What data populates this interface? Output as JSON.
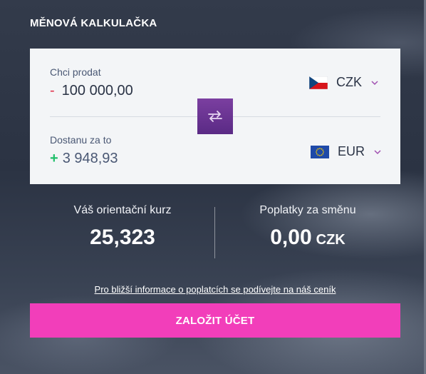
{
  "title": "MĚNOVÁ KALKULAČKA",
  "sell": {
    "label": "Chci prodat",
    "sign": "-",
    "amount": "100 000,00",
    "currency": "CZK",
    "flag_icon": "czech-flag-icon"
  },
  "receive": {
    "label": "Dostanu za to",
    "sign": "+",
    "amount": "3 948,93",
    "currency": "EUR",
    "flag_icon": "eu-flag-icon"
  },
  "swap_icon": "swap-arrows-icon",
  "rate": {
    "label": "Váš orientační kurz",
    "value": "25,323"
  },
  "fees": {
    "label": "Poplatky za směnu",
    "value": "0,00",
    "unit": "CZK"
  },
  "info_link": "Pro bližší informace o poplatcích se podívejte na náš ceník",
  "cta_label": "ZALOŽIT ÚČET",
  "colors": {
    "accent_pink": "#f23eba",
    "swap_purple": "#6a3294",
    "minus_red": "#e0314b",
    "plus_green": "#1fbf6a",
    "card_bg": "#f3f5f7"
  }
}
